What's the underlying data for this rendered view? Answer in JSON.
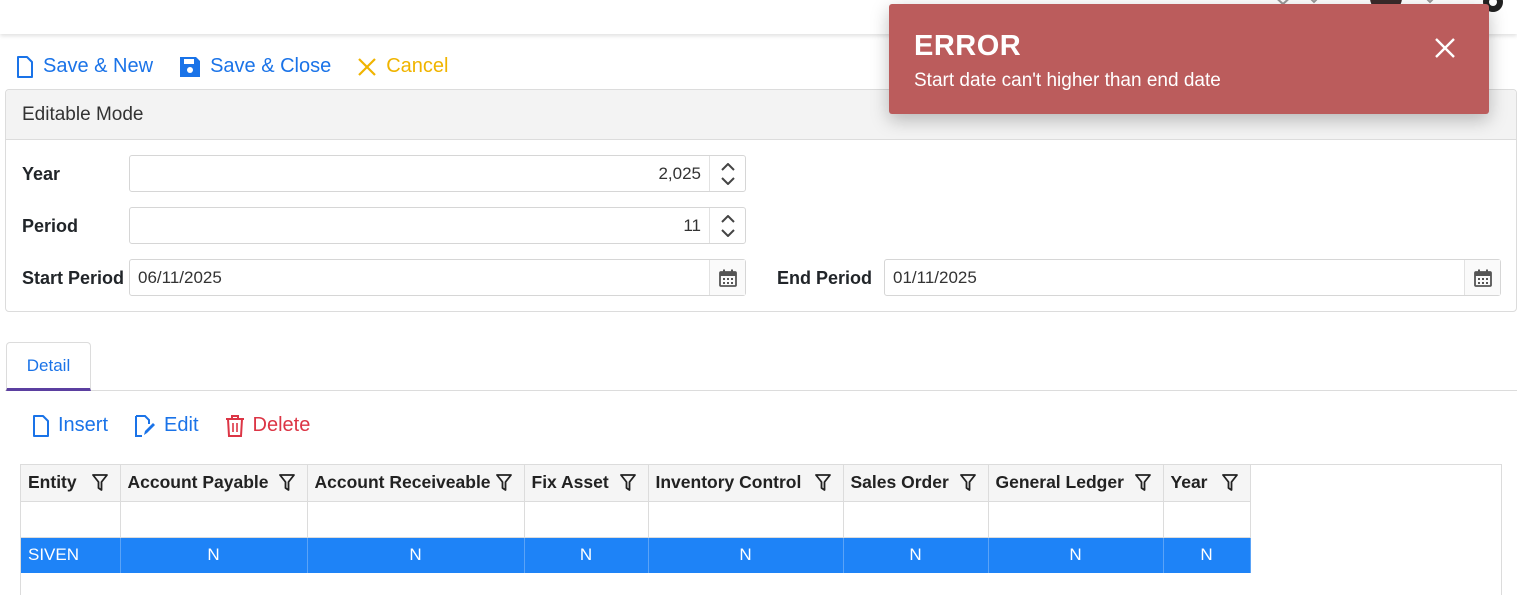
{
  "toolbar": {
    "save_new": "Save & New",
    "save_close": "Save & Close",
    "cancel": "Cancel"
  },
  "panel": {
    "title": "Editable Mode",
    "year_label": "Year",
    "year_value": "2,025",
    "period_label": "Period",
    "period_value": "11",
    "start_label": "Start Period",
    "start_value": "06/11/2025",
    "end_label": "End Period",
    "end_value": "01/11/2025"
  },
  "tabs": [
    {
      "label": "Detail",
      "active": true
    }
  ],
  "grid_toolbar": {
    "insert": "Insert",
    "edit": "Edit",
    "delete": "Delete"
  },
  "grid": {
    "columns": [
      "Entity",
      "Account Payable",
      "Account Receiveable",
      "Fix Asset",
      "Inventory Control",
      "Sales Order",
      "General Ledger",
      "Year"
    ],
    "rows": [
      [
        "SIVEN",
        "N",
        "N",
        "N",
        "N",
        "N",
        "N",
        "N"
      ]
    ]
  },
  "toast": {
    "title": "ERROR",
    "message": "Start date can't higher than end date"
  },
  "colors": {
    "primary": "#1a73e8",
    "cancel": "#f0b400",
    "danger": "#dc3545",
    "selected_row": "#1e83f7",
    "toast_bg": "#bb5c5c",
    "tab_underline": "#5b3fa0"
  }
}
